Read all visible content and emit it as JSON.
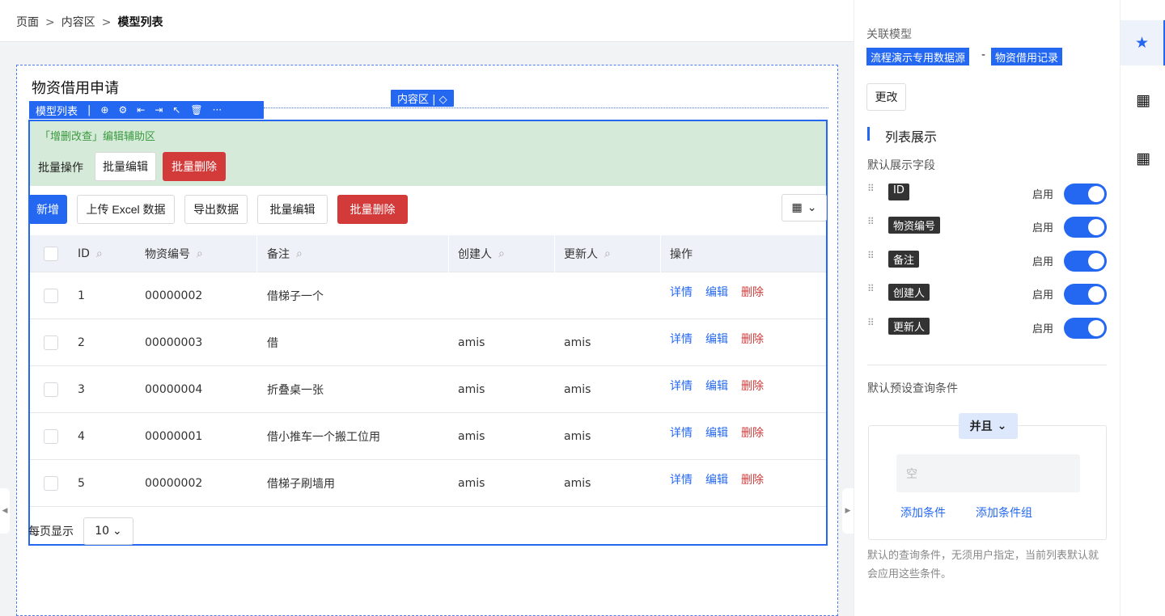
{
  "breadcrumb": {
    "item1": "页面",
    "sep": ">",
    "item2": "内容区",
    "current": "模型列表"
  },
  "canvas": {
    "page_title": "物资借用申请",
    "content_tag": "内容区 | ◇",
    "model_bar_label": "模型列表",
    "model_bar_tools": [
      "⊕",
      "⚙",
      "⇤",
      "⇥",
      "↖",
      "🗑",
      "···"
    ]
  },
  "helper": {
    "title": "「增删改查」编辑辅助区",
    "batch_label": "批量操作",
    "batch_edit": "批量编辑",
    "batch_delete": "批量删除"
  },
  "toolbar": {
    "add": "新增",
    "upload": "上传 Excel 数据",
    "export": "导出数据",
    "batch_edit": "批量编辑",
    "batch_delete": "批量删除",
    "columns_icon": "grid-icon"
  },
  "table": {
    "headers": [
      "ID",
      "物资编号",
      "备注",
      "创建人",
      "更新人",
      "操作"
    ],
    "rows": [
      {
        "id": "1",
        "code": "00000002",
        "note": "借梯子一个",
        "creator": "",
        "updater": ""
      },
      {
        "id": "2",
        "code": "00000003",
        "note": "借",
        "creator": "amis",
        "updater": "amis"
      },
      {
        "id": "3",
        "code": "00000004",
        "note": "折叠桌一张",
        "creator": "amis",
        "updater": "amis"
      },
      {
        "id": "4",
        "code": "00000001",
        "note": "借小推车一个搬工位用",
        "creator": "amis",
        "updater": "amis"
      },
      {
        "id": "5",
        "code": "00000002",
        "note": "借梯子刷墙用",
        "creator": "amis",
        "updater": "amis"
      }
    ],
    "ops": {
      "detail": "详情",
      "edit": "编辑",
      "delete": "删除"
    }
  },
  "pager": {
    "label": "每页显示",
    "value": "10"
  },
  "panel": {
    "related_label": "关联模型",
    "source": "流程演示专用数据源",
    "dash": "-",
    "model": "物资借用记录",
    "change_btn": "更改",
    "section_title": "列表展示",
    "default_fields_label": "默认展示字段",
    "enable_label": "启用",
    "fields": [
      "ID",
      "物资编号",
      "备注",
      "创建人",
      "更新人"
    ],
    "preset_label": "默认预设查询条件",
    "and_label": "并且",
    "empty": "空",
    "add_condition": "添加条件",
    "add_group": "添加条件组",
    "hint": "默认的查询条件，无须用户指定，当前列表默认就会应用这些条件。"
  },
  "colors": {
    "accent": "#2468f2",
    "danger": "#d33a3a",
    "helper_bg": "#d5ead8"
  }
}
